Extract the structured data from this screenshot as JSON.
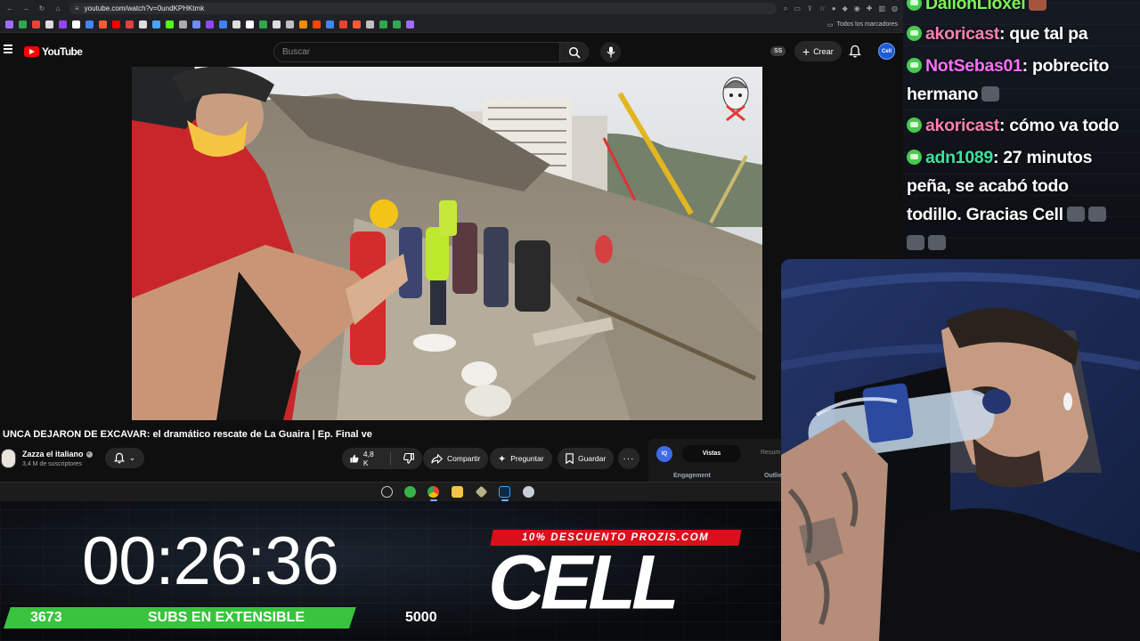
{
  "browser": {
    "url": "youtube.com/watch?v=0undKPHKtmk",
    "bookmarks_all": "Todos los marcadores"
  },
  "youtube": {
    "logo_text": "YouTube",
    "search_placeholder": "Buscar",
    "ss_badge": "SS",
    "create_label": "Crear",
    "avatar_text": "Cell"
  },
  "video": {
    "title": "UNCA DEJARON DE EXCAVAR: el dramático rescate de La Guaira | Ep. Final ve",
    "channel_name": "Zazza el italiano",
    "channel_subs": "3,4 M de suscriptores",
    "likes": "4,8 K",
    "share_label": "Compartir",
    "ask_label": "Preguntar",
    "save_label": "Guardar",
    "more_label": "···"
  },
  "analytics": {
    "badge": "IQ",
    "tab_active": "Vistas",
    "tab_other": "Resum",
    "label_engagement": "Engagement",
    "label_outlier": "Outlie"
  },
  "chat": {
    "messages": [
      {
        "user": "DallonLioxel",
        "user_color": "#7cf25a",
        "text": ""
      },
      {
        "user": "akoricast",
        "user_color": "#ff7fb0",
        "text": ": que tal pa"
      },
      {
        "user": "NotSebas01",
        "user_color": "#ff6fff",
        "text": ": pobrecito"
      },
      {
        "user": "",
        "user_color": "#ffffff",
        "text": "hermano"
      },
      {
        "user": "akoricast",
        "user_color": "#ff7fb0",
        "text": ": cómo va todo"
      },
      {
        "user": "adn1089",
        "user_color": "#3fe0a0",
        "text": ": 27 minutos"
      },
      {
        "user": "",
        "user_color": "#ffffff",
        "text": "peña, se acabó todo"
      },
      {
        "user": "",
        "user_color": "#ffffff",
        "text": "todillo. Gracias Cell"
      }
    ]
  },
  "overlay": {
    "timer": "00:26:36",
    "subs_current": "3673",
    "subs_label": "SUBS EN EXTENSIBLE",
    "subs_goal": "5000",
    "subs_progress": 0.7346,
    "promo": "10% DESCUENTO PROZIS.COM",
    "brand": "CELL"
  },
  "colors": {
    "yt_red": "#ff0000",
    "subs_green": "#38c43c",
    "promo_red": "#d90f1b",
    "chat_badge": "#47c94f"
  }
}
